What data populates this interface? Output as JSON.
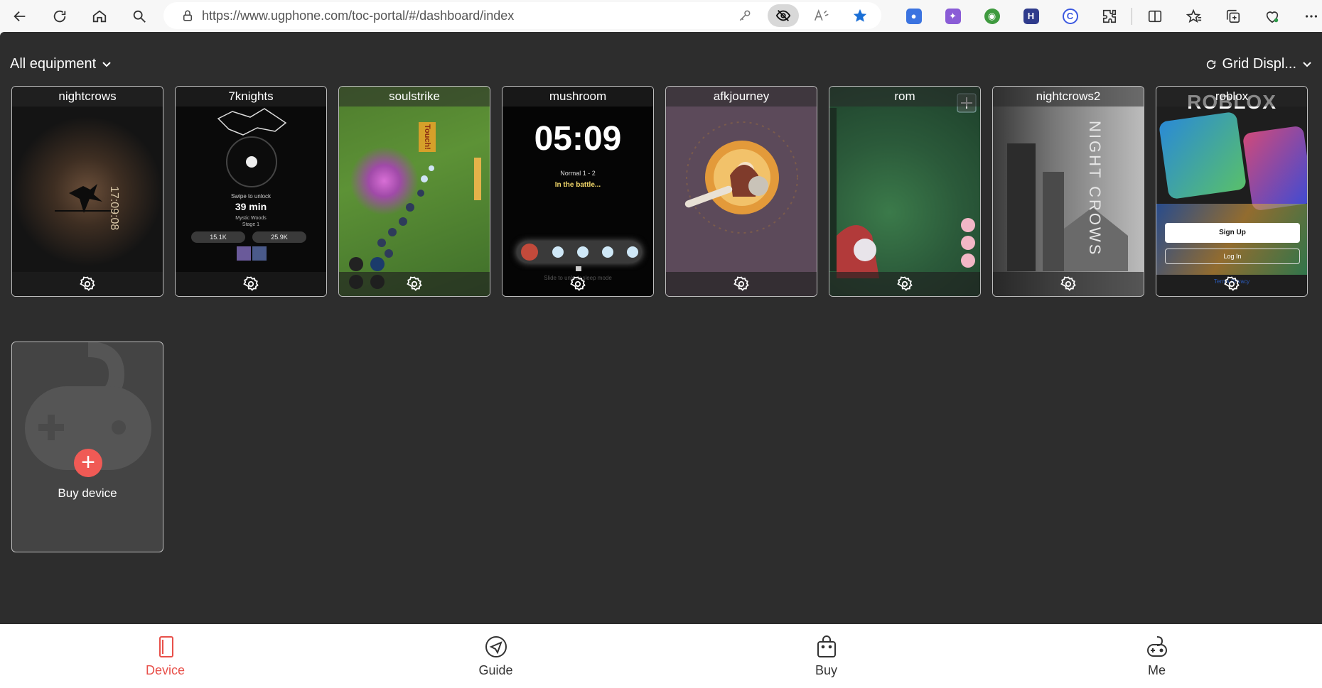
{
  "browser": {
    "url": "https://www.ugphone.com/toc-portal/#/dashboard/index"
  },
  "toolbar": {
    "filter_label": "All equipment",
    "view_label": "Grid Displ..."
  },
  "devices": [
    {
      "name": "nightcrows",
      "screen_text": "17:09:08"
    },
    {
      "name": "7knights",
      "swipe": "Swipe to unlock",
      "time": "39 min",
      "stage_name": "Mystic Woods",
      "stage": "Stage 1",
      "stat1": "15.1K",
      "stat2": "25.9K"
    },
    {
      "name": "soulstrike",
      "screen_text": "Touch!"
    },
    {
      "name": "mushroom",
      "clock": "05:09",
      "mode": "Normal 1 - 2",
      "status": "In the battle...",
      "hint": "Slide to unlock sleep mode"
    },
    {
      "name": "afkjourney"
    },
    {
      "name": "rom"
    },
    {
      "name": "nightcrows2",
      "screen_text": "NIGHT CROWS"
    },
    {
      "name": "roblox",
      "logo": "ROBLOX",
      "signup": "Sign Up",
      "login": "Log In",
      "terms": "Terms Privacy"
    }
  ],
  "buy_device": {
    "label": "Buy device"
  },
  "bottom_nav": [
    {
      "label": "Device"
    },
    {
      "label": "Guide"
    },
    {
      "label": "Buy"
    },
    {
      "label": "Me"
    }
  ],
  "colors": {
    "accent": "#e8504a",
    "app_bg": "#2d2d2d",
    "card_border": "#bdbdbd"
  }
}
